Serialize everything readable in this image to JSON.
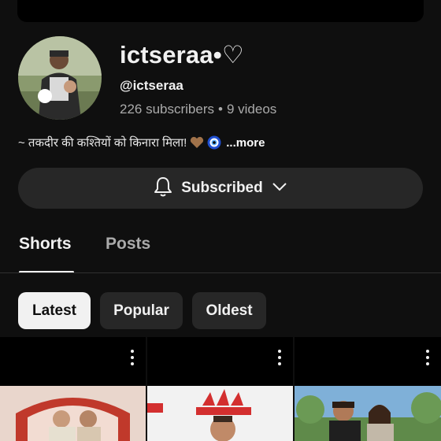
{
  "channel": {
    "name": "ictseraa•♡",
    "handle": "@ictseraa",
    "subscribers": "226 subscribers",
    "separator": "•",
    "videos": "9 videos",
    "description": "~ तकदीर की कश्तियों को किनारा मिला!",
    "more_label": "...more"
  },
  "subscribe_button": {
    "label": "Subscribed",
    "bell_icon": "bell-icon",
    "chevron_icon": "chevron-down-icon"
  },
  "tabs": [
    {
      "label": "Shorts",
      "selected": true
    },
    {
      "label": "Posts",
      "selected": false
    }
  ],
  "filters": [
    {
      "label": "Latest",
      "selected": true
    },
    {
      "label": "Popular",
      "selected": false
    },
    {
      "label": "Oldest",
      "selected": false
    }
  ],
  "shorts": [
    {
      "thumbnail": "wedding-couple-photo",
      "menu_icon": "more-vert-icon"
    },
    {
      "thumbnail": "adidas-person-photo",
      "menu_icon": "more-vert-icon"
    },
    {
      "thumbnail": "couple-outdoor-photo",
      "menu_icon": "more-vert-icon"
    }
  ],
  "colors": {
    "background": "#0f0f0f",
    "surface": "#272727",
    "text_primary": "#f1f1f1",
    "text_secondary": "#aaaaaa",
    "chip_selected_bg": "#f1f1f1"
  }
}
